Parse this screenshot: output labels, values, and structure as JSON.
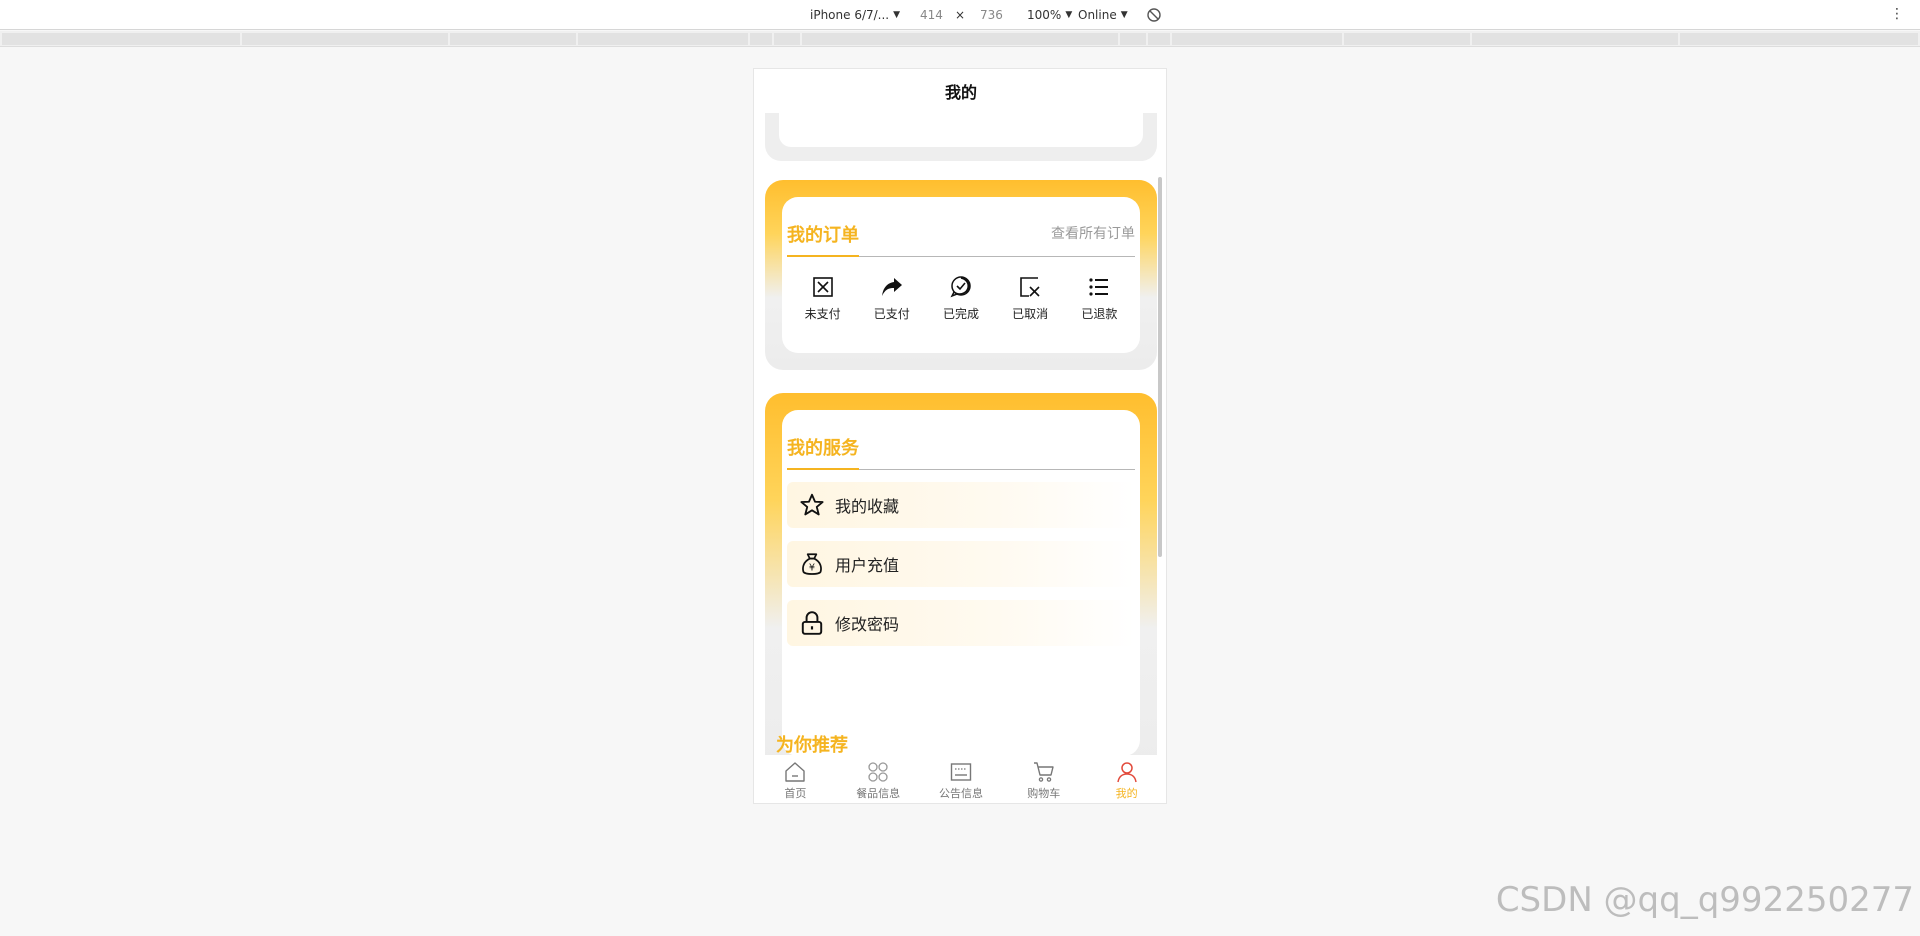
{
  "devtools": {
    "device": "iPhone 6/7/...",
    "width": "414",
    "times": "×",
    "height": "736",
    "zoom": "100%",
    "network": "Online",
    "caret": "▼",
    "kebab": "⋮"
  },
  "page": {
    "title": "我的"
  },
  "orders": {
    "title": "我的订单",
    "view_all": "查看所有订单",
    "items": [
      {
        "label": "未支付",
        "icon": "unpaid-icon"
      },
      {
        "label": "已支付",
        "icon": "paid-icon"
      },
      {
        "label": "已完成",
        "icon": "completed-icon"
      },
      {
        "label": "已取消",
        "icon": "cancelled-icon"
      },
      {
        "label": "已退款",
        "icon": "refunded-icon"
      }
    ]
  },
  "services": {
    "title": "我的服务",
    "items": [
      {
        "label": "我的收藏",
        "icon": "star-icon"
      },
      {
        "label": "用户充值",
        "icon": "money-bag-icon"
      },
      {
        "label": "修改密码",
        "icon": "lock-icon"
      }
    ]
  },
  "recommend": {
    "title": "为你推荐"
  },
  "tabbar": {
    "items": [
      {
        "label": "首页",
        "icon": "home-icon",
        "active": false
      },
      {
        "label": "餐品信息",
        "icon": "grid-icon",
        "active": false
      },
      {
        "label": "公告信息",
        "icon": "notice-icon",
        "active": false
      },
      {
        "label": "购物车",
        "icon": "cart-icon",
        "active": false
      },
      {
        "label": "我的",
        "icon": "user-icon",
        "active": true
      }
    ]
  },
  "colors": {
    "accent": "#f5b420",
    "active_tab": "#f5b420"
  },
  "watermark": "CSDN @qq_q992250277"
}
